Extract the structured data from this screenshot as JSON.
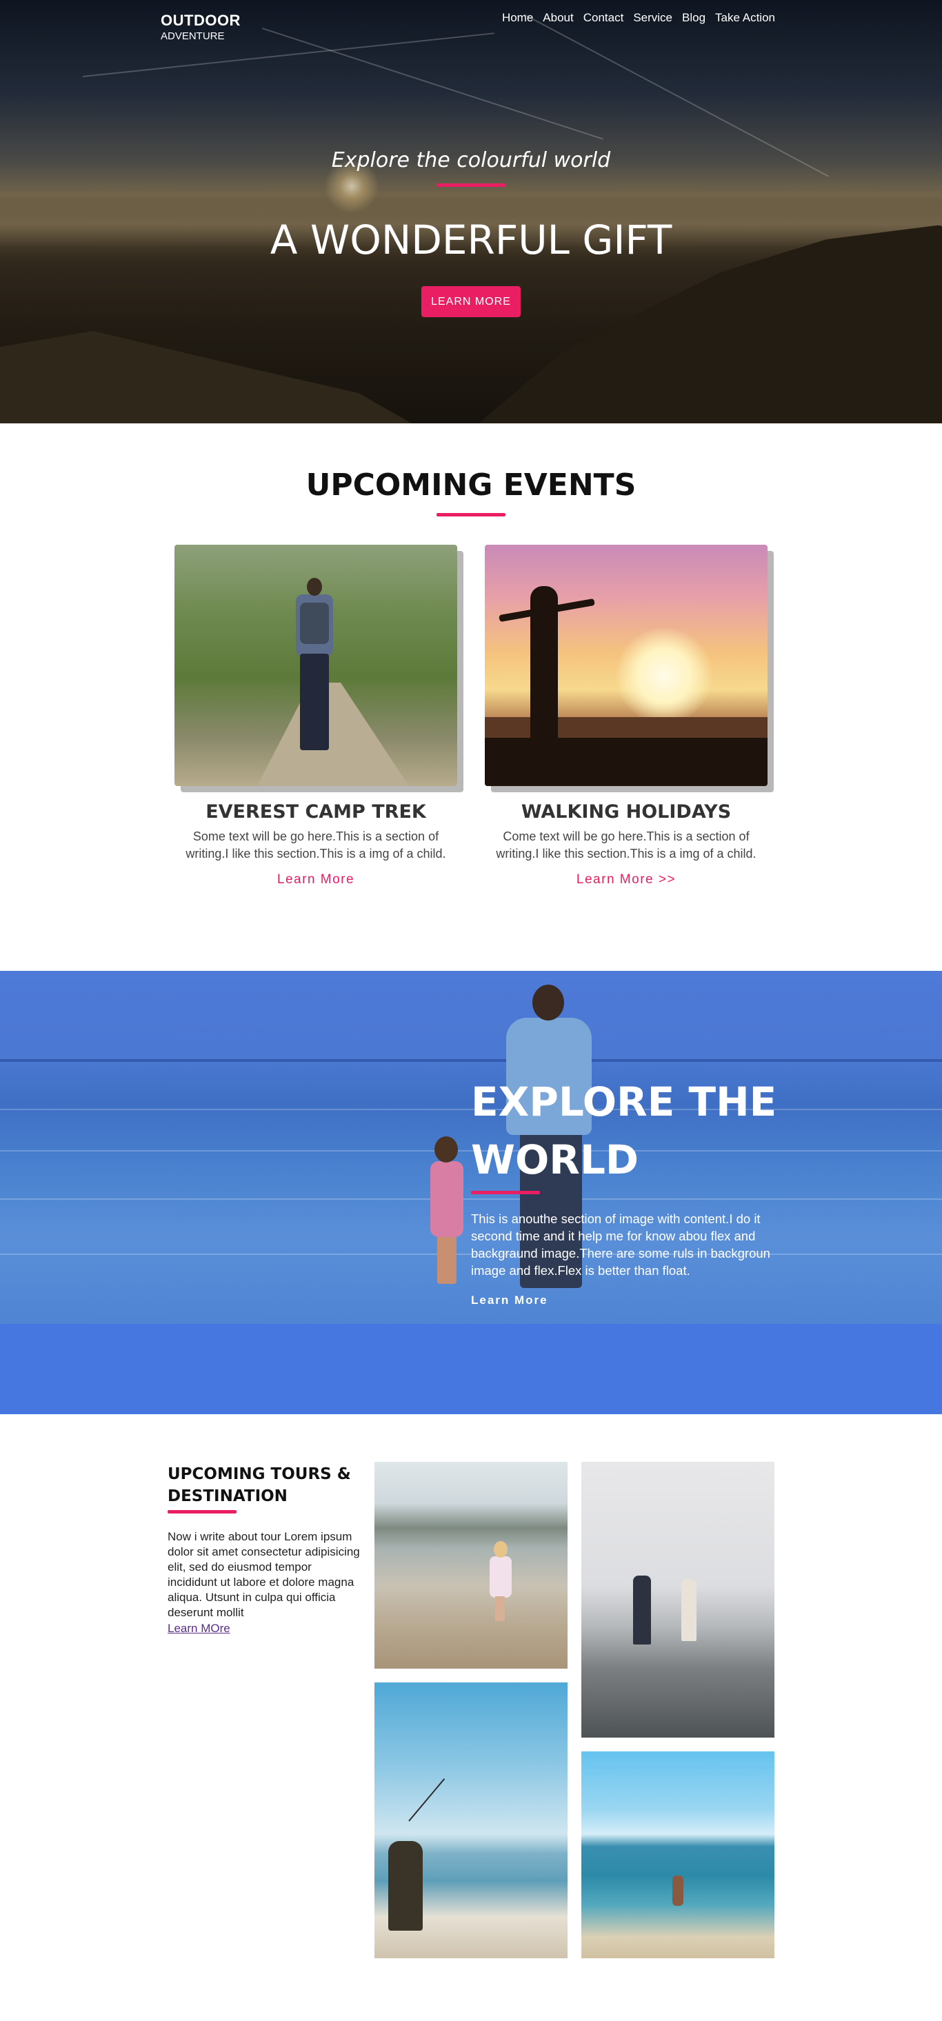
{
  "header": {
    "logo_line1": "OUTDOOR",
    "logo_line2": "ADVENTURE",
    "nav": [
      "Home",
      "About",
      "Contact",
      "Service",
      "Blog",
      "Take Action"
    ]
  },
  "hero": {
    "subtitle": "Explore the colourful world",
    "title": "A WONDERFUL GIFT",
    "button": "LEARN MORE"
  },
  "events": {
    "heading": "UPCOMING EVENTS",
    "cards": [
      {
        "title": "EVEREST CAMP TREK",
        "text": "Some text will be go here.This is a section of writing.I like this section.This is a img of a child.",
        "link": "Learn More"
      },
      {
        "title": "WALKING HOLIDAYS",
        "text": "Come text will be go here.This is a section of writing.I like this section.This is a img of a child.",
        "link": "Learn More >>"
      }
    ]
  },
  "explore": {
    "title": "EXPLORE THE WORLD",
    "text": "This is anouthe section of image with content.I do it second time and it help me for know abou flex and backgraund image.There are some ruls in backgroun image and flex.Flex is better than float.",
    "link": "Learn More"
  },
  "tours": {
    "heading": "UPCOMING TOURS & DESTINATION",
    "text": "Now i write about tour Lorem ipsum dolor sit amet consectetur adipisicing elit, sed do eiusmod tempor incididunt ut labore et dolore magna aliqua. Utsunt in culpa qui officia deserunt mollit",
    "link": "Learn MOre"
  },
  "colors": {
    "accent": "#e91e63",
    "explore_overlay": "#4a7fdd",
    "link_visited": "#5a2d8c"
  }
}
